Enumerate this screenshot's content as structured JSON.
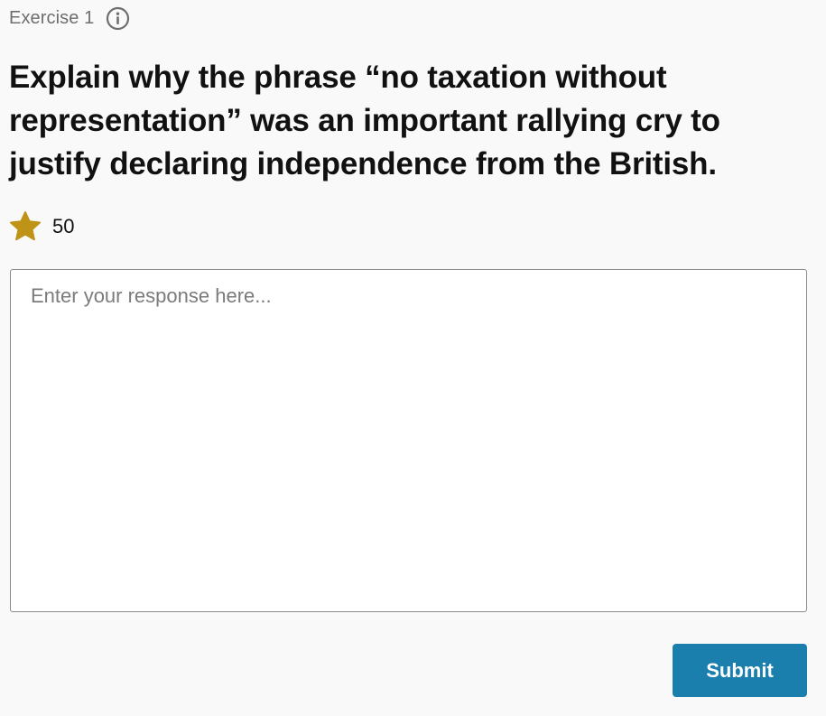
{
  "exercise": {
    "label": "Exercise 1",
    "info_icon": "info-icon"
  },
  "question": {
    "text": "Explain why the phrase “no taxation without representation” was an important rallying cry to justify declaring independence from the British."
  },
  "points": {
    "icon": "star-icon",
    "value": "50"
  },
  "response": {
    "placeholder": "Enter your response here...",
    "value": ""
  },
  "actions": {
    "submit_label": "Submit"
  },
  "colors": {
    "background": "#f9f9f9",
    "star": "#bf9317",
    "submit_button": "#1b7fad",
    "muted_text": "#6e6e6e"
  }
}
